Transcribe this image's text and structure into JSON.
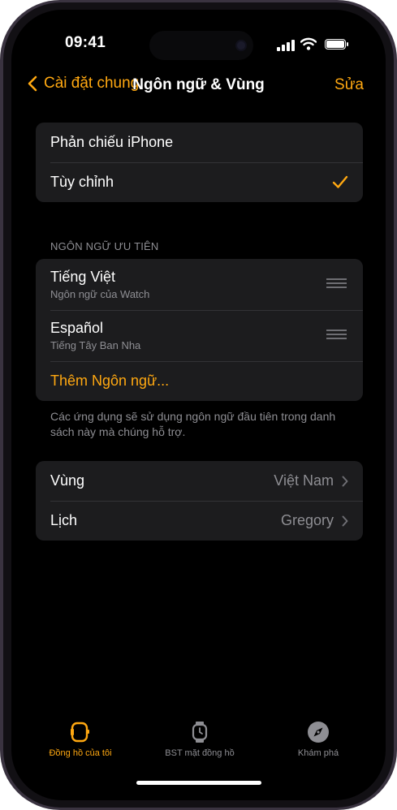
{
  "status": {
    "time": "09:41"
  },
  "nav": {
    "back_label": "Cài đặt chung",
    "title": "Ngôn ngữ & Vùng",
    "edit_label": "Sửa"
  },
  "mirror_group": {
    "items": [
      {
        "label": "Phản chiếu iPhone",
        "selected": false
      },
      {
        "label": "Tùy chỉnh",
        "selected": true,
        "icon": "checkmark-icon"
      }
    ]
  },
  "languages": {
    "header": "NGÔN NGỮ ƯU TIÊN",
    "items": [
      {
        "label": "Tiếng Việt",
        "sub": "Ngôn ngữ của Watch",
        "icon": "reorder-grip-icon"
      },
      {
        "label": "Español",
        "sub": "Tiếng Tây Ban Nha",
        "icon": "reorder-grip-icon"
      }
    ],
    "add_label": "Thêm Ngôn ngữ...",
    "footer": "Các ứng dụng sẽ sử dụng ngôn ngữ đầu tiên trong danh sách này mà chúng hỗ trợ."
  },
  "region_group": {
    "items": [
      {
        "label": "Vùng",
        "value": "Việt Nam",
        "icon": "chevron-right-icon"
      },
      {
        "label": "Lịch",
        "value": "Gregory",
        "icon": "chevron-right-icon"
      }
    ]
  },
  "tabs": [
    {
      "label": "Đồng hồ của tôi",
      "icon": "watch-icon",
      "active": true
    },
    {
      "label": "BST mặt đồng hồ",
      "icon": "watch-face-icon",
      "active": false
    },
    {
      "label": "Khám phá",
      "icon": "compass-icon",
      "active": false
    }
  ],
  "colors": {
    "accent": "#ffa811",
    "background": "#000000",
    "cell": "#1c1c1e",
    "secondary_text": "#8e8e93"
  }
}
